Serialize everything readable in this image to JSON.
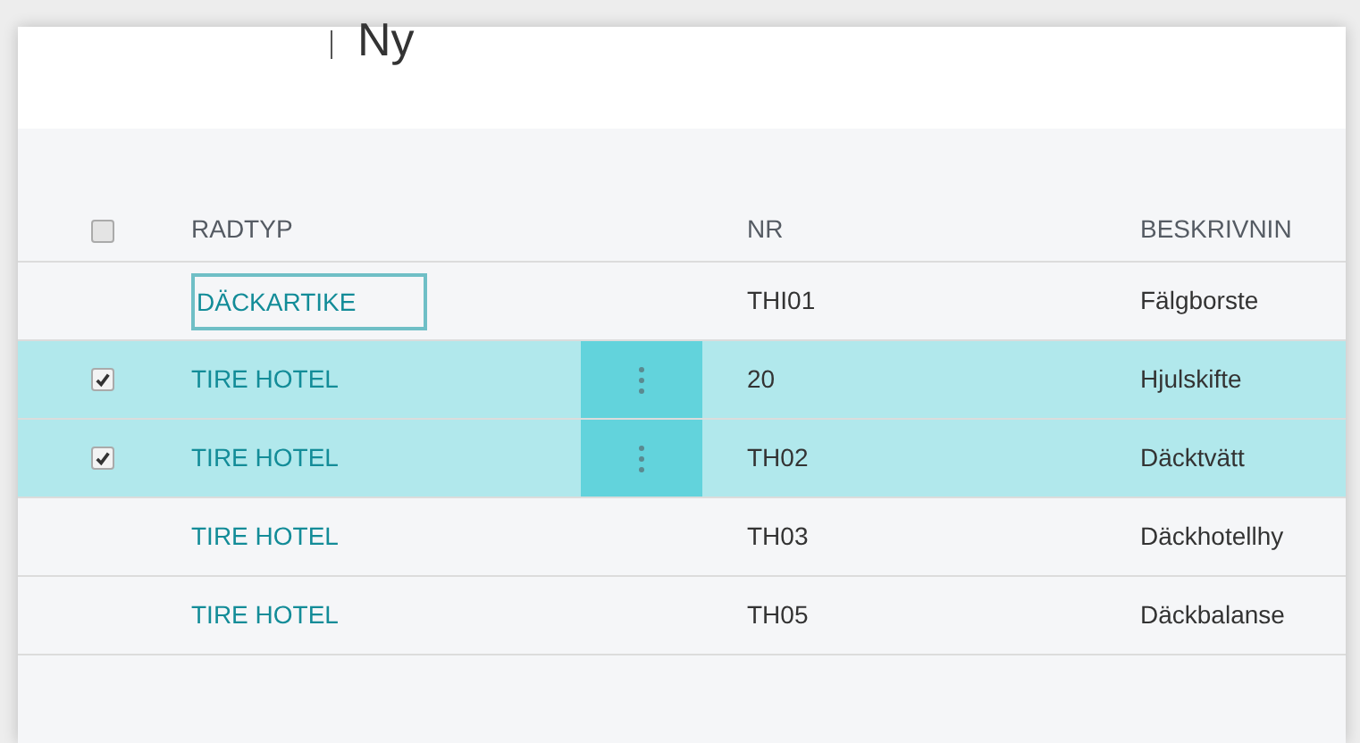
{
  "header": {
    "title": "Ny"
  },
  "table": {
    "header_checkbox": {
      "checked": false
    },
    "columns": [
      "RADTYP",
      "NR",
      "BESKRIVNIN"
    ],
    "rows": [
      {
        "kind": "input",
        "selected": false,
        "checked": false,
        "radtyp": "DÄCKARTIKE",
        "nr": "THI01",
        "beskrivning": "Fälgborste"
      },
      {
        "kind": "link",
        "selected": true,
        "checked": true,
        "radtyp": "TIRE HOTEL",
        "nr": "20",
        "beskrivning": "Hjulskifte"
      },
      {
        "kind": "link",
        "selected": true,
        "checked": true,
        "radtyp": "TIRE HOTEL",
        "nr": "TH02",
        "beskrivning": "Däcktvätt"
      },
      {
        "kind": "link",
        "selected": false,
        "checked": false,
        "radtyp": "TIRE HOTEL",
        "nr": "TH03",
        "beskrivning": "Däckhotellhy"
      },
      {
        "kind": "link",
        "selected": false,
        "checked": false,
        "radtyp": "TIRE HOTEL",
        "nr": "TH05",
        "beskrivning": "Däckbalanse"
      }
    ]
  }
}
